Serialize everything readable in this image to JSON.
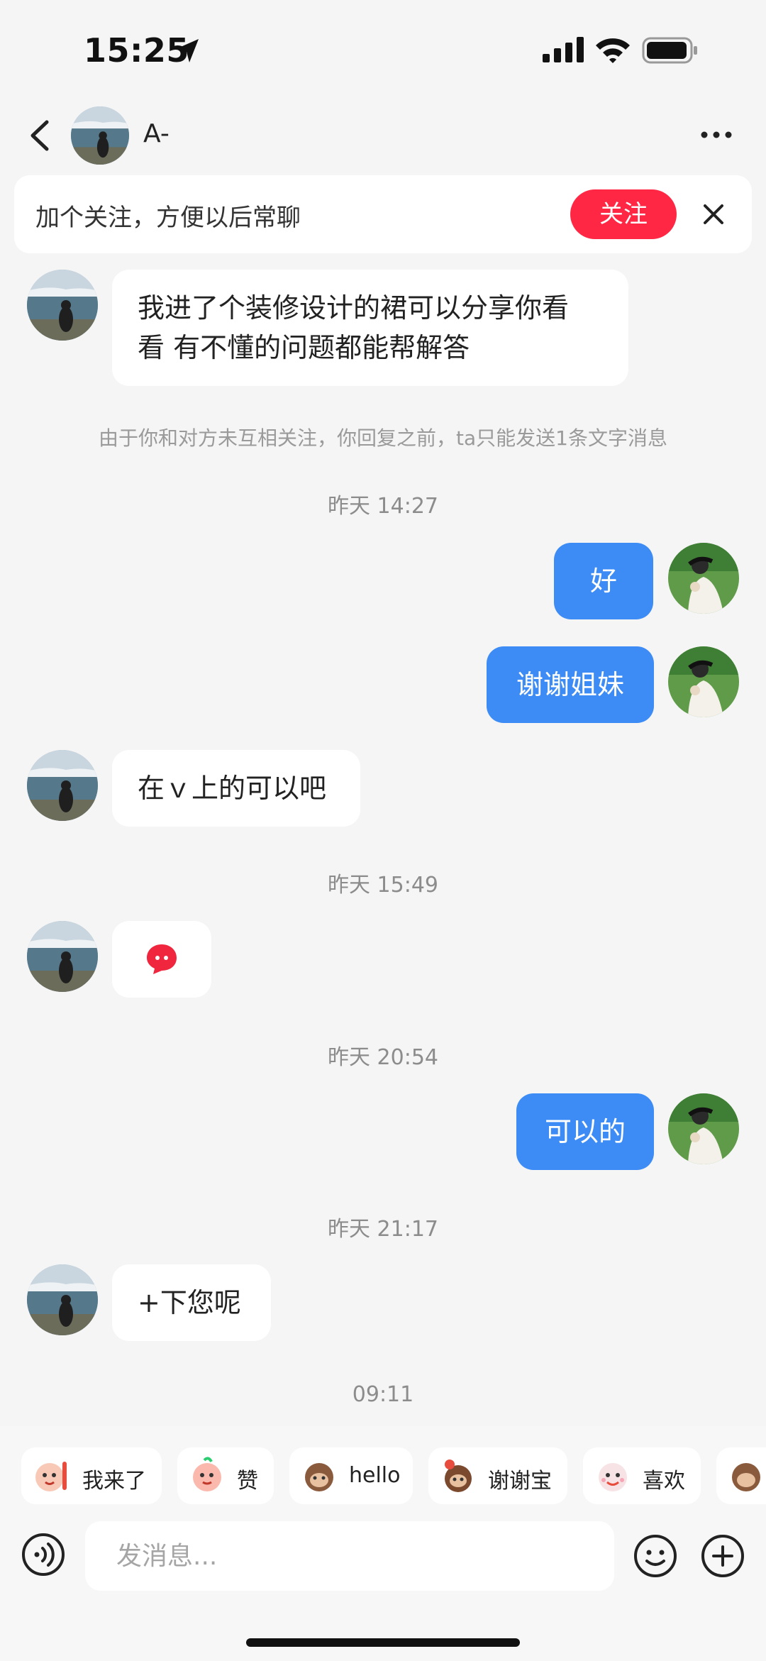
{
  "status_bar": {
    "time": "15:25"
  },
  "header": {
    "peer_name": "A-"
  },
  "follow_banner": {
    "text": "加个关注，方便以后常聊",
    "button_label": "关注"
  },
  "messages": [
    {
      "from": "peer",
      "line1": "我进了个装修设计的裙可以分享你看",
      "line2": "看 有不懂的问题都能帮解答"
    },
    {
      "from": "me",
      "text": "好"
    },
    {
      "from": "me",
      "text": "谢谢姐妹"
    },
    {
      "from": "peer",
      "text": "在ｖ上的可以吧"
    },
    {
      "from": "peer",
      "sticker": "red-chat-bubble"
    },
    {
      "from": "me",
      "text": "可以的"
    },
    {
      "from": "peer",
      "text": "+下您呢"
    }
  ],
  "notice": "由于你和对方未互相关注，你回复之前，ta只能发送1条文字消息",
  "timestamps": [
    "昨天 14:27",
    "昨天 15:49",
    "昨天 20:54",
    "昨天 21:17",
    "09:11"
  ],
  "quick_replies": [
    "我来了",
    "赞",
    "hello",
    "谢谢宝",
    "喜欢"
  ],
  "input": {
    "placeholder": "发消息..."
  },
  "colors": {
    "accent_blue": "#3d8cf6",
    "follow_red": "#ff2744",
    "background": "#f5f5f5"
  },
  "icons": [
    "location-arrow-icon",
    "signal-icon",
    "wifi-icon",
    "battery-icon",
    "back-icon",
    "more-icon",
    "close-icon",
    "voice-icon",
    "emoji-icon",
    "plus-icon"
  ]
}
